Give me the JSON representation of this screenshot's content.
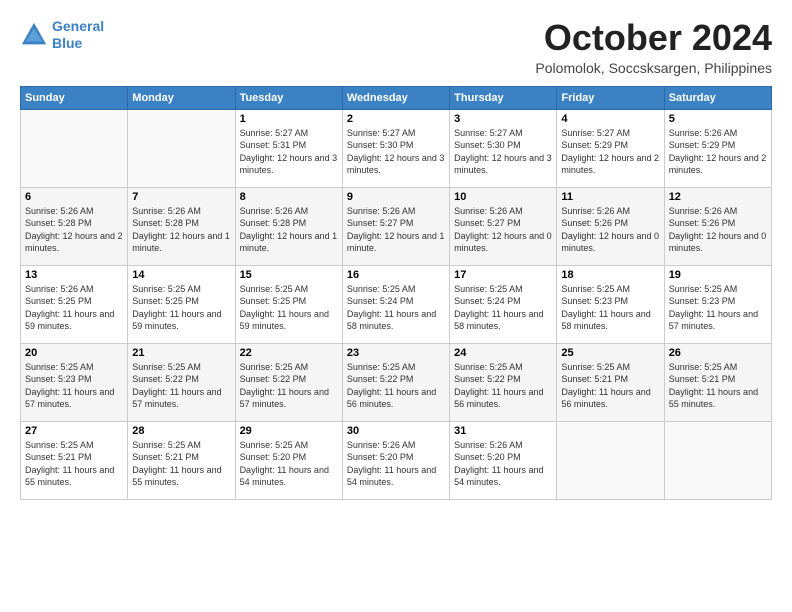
{
  "logo": {
    "line1": "General",
    "line2": "Blue"
  },
  "title": "October 2024",
  "location": "Polomolok, Soccsksargen, Philippines",
  "days_header": [
    "Sunday",
    "Monday",
    "Tuesday",
    "Wednesday",
    "Thursday",
    "Friday",
    "Saturday"
  ],
  "weeks": [
    [
      {
        "num": "",
        "detail": ""
      },
      {
        "num": "",
        "detail": ""
      },
      {
        "num": "1",
        "detail": "Sunrise: 5:27 AM\nSunset: 5:31 PM\nDaylight: 12 hours and 3 minutes."
      },
      {
        "num": "2",
        "detail": "Sunrise: 5:27 AM\nSunset: 5:30 PM\nDaylight: 12 hours and 3 minutes."
      },
      {
        "num": "3",
        "detail": "Sunrise: 5:27 AM\nSunset: 5:30 PM\nDaylight: 12 hours and 3 minutes."
      },
      {
        "num": "4",
        "detail": "Sunrise: 5:27 AM\nSunset: 5:29 PM\nDaylight: 12 hours and 2 minutes."
      },
      {
        "num": "5",
        "detail": "Sunrise: 5:26 AM\nSunset: 5:29 PM\nDaylight: 12 hours and 2 minutes."
      }
    ],
    [
      {
        "num": "6",
        "detail": "Sunrise: 5:26 AM\nSunset: 5:28 PM\nDaylight: 12 hours and 2 minutes."
      },
      {
        "num": "7",
        "detail": "Sunrise: 5:26 AM\nSunset: 5:28 PM\nDaylight: 12 hours and 1 minute."
      },
      {
        "num": "8",
        "detail": "Sunrise: 5:26 AM\nSunset: 5:28 PM\nDaylight: 12 hours and 1 minute."
      },
      {
        "num": "9",
        "detail": "Sunrise: 5:26 AM\nSunset: 5:27 PM\nDaylight: 12 hours and 1 minute."
      },
      {
        "num": "10",
        "detail": "Sunrise: 5:26 AM\nSunset: 5:27 PM\nDaylight: 12 hours and 0 minutes."
      },
      {
        "num": "11",
        "detail": "Sunrise: 5:26 AM\nSunset: 5:26 PM\nDaylight: 12 hours and 0 minutes."
      },
      {
        "num": "12",
        "detail": "Sunrise: 5:26 AM\nSunset: 5:26 PM\nDaylight: 12 hours and 0 minutes."
      }
    ],
    [
      {
        "num": "13",
        "detail": "Sunrise: 5:26 AM\nSunset: 5:25 PM\nDaylight: 11 hours and 59 minutes."
      },
      {
        "num": "14",
        "detail": "Sunrise: 5:25 AM\nSunset: 5:25 PM\nDaylight: 11 hours and 59 minutes."
      },
      {
        "num": "15",
        "detail": "Sunrise: 5:25 AM\nSunset: 5:25 PM\nDaylight: 11 hours and 59 minutes."
      },
      {
        "num": "16",
        "detail": "Sunrise: 5:25 AM\nSunset: 5:24 PM\nDaylight: 11 hours and 58 minutes."
      },
      {
        "num": "17",
        "detail": "Sunrise: 5:25 AM\nSunset: 5:24 PM\nDaylight: 11 hours and 58 minutes."
      },
      {
        "num": "18",
        "detail": "Sunrise: 5:25 AM\nSunset: 5:23 PM\nDaylight: 11 hours and 58 minutes."
      },
      {
        "num": "19",
        "detail": "Sunrise: 5:25 AM\nSunset: 5:23 PM\nDaylight: 11 hours and 57 minutes."
      }
    ],
    [
      {
        "num": "20",
        "detail": "Sunrise: 5:25 AM\nSunset: 5:23 PM\nDaylight: 11 hours and 57 minutes."
      },
      {
        "num": "21",
        "detail": "Sunrise: 5:25 AM\nSunset: 5:22 PM\nDaylight: 11 hours and 57 minutes."
      },
      {
        "num": "22",
        "detail": "Sunrise: 5:25 AM\nSunset: 5:22 PM\nDaylight: 11 hours and 57 minutes."
      },
      {
        "num": "23",
        "detail": "Sunrise: 5:25 AM\nSunset: 5:22 PM\nDaylight: 11 hours and 56 minutes."
      },
      {
        "num": "24",
        "detail": "Sunrise: 5:25 AM\nSunset: 5:22 PM\nDaylight: 11 hours and 56 minutes."
      },
      {
        "num": "25",
        "detail": "Sunrise: 5:25 AM\nSunset: 5:21 PM\nDaylight: 11 hours and 56 minutes."
      },
      {
        "num": "26",
        "detail": "Sunrise: 5:25 AM\nSunset: 5:21 PM\nDaylight: 11 hours and 55 minutes."
      }
    ],
    [
      {
        "num": "27",
        "detail": "Sunrise: 5:25 AM\nSunset: 5:21 PM\nDaylight: 11 hours and 55 minutes."
      },
      {
        "num": "28",
        "detail": "Sunrise: 5:25 AM\nSunset: 5:21 PM\nDaylight: 11 hours and 55 minutes."
      },
      {
        "num": "29",
        "detail": "Sunrise: 5:25 AM\nSunset: 5:20 PM\nDaylight: 11 hours and 54 minutes."
      },
      {
        "num": "30",
        "detail": "Sunrise: 5:26 AM\nSunset: 5:20 PM\nDaylight: 11 hours and 54 minutes."
      },
      {
        "num": "31",
        "detail": "Sunrise: 5:26 AM\nSunset: 5:20 PM\nDaylight: 11 hours and 54 minutes."
      },
      {
        "num": "",
        "detail": ""
      },
      {
        "num": "",
        "detail": ""
      }
    ]
  ]
}
